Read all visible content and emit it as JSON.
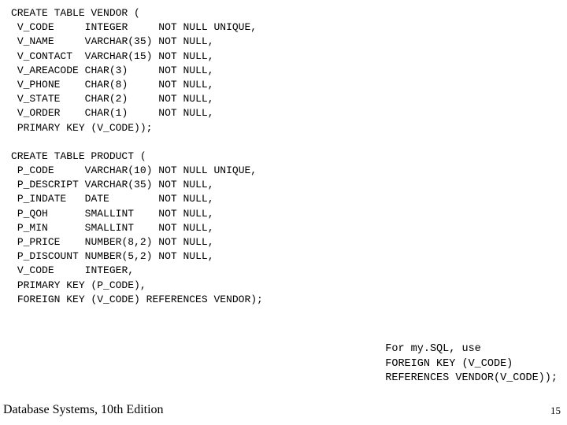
{
  "vendor": {
    "header": "CREATE TABLE VENDOR (",
    "rows": [
      {
        "col": "V_CODE",
        "type": "INTEGER",
        "cons": "NOT NULL UNIQUE,"
      },
      {
        "col": "V_NAME",
        "type": "VARCHAR(35)",
        "cons": "NOT NULL,"
      },
      {
        "col": "V_CONTACT",
        "type": "VARCHAR(15)",
        "cons": "NOT NULL,"
      },
      {
        "col": "V_AREACODE",
        "type": "CHAR(3)",
        "cons": "NOT NULL,"
      },
      {
        "col": "V_PHONE",
        "type": "CHAR(8)",
        "cons": "NOT NULL,"
      },
      {
        "col": "V_STATE",
        "type": "CHAR(2)",
        "cons": "NOT NULL,"
      },
      {
        "col": "V_ORDER",
        "type": "CHAR(1)",
        "cons": "NOT NULL,"
      }
    ],
    "footer": "PRIMARY KEY (V_CODE));"
  },
  "product": {
    "header": "CREATE TABLE PRODUCT (",
    "rows": [
      {
        "col": "P_CODE",
        "type": "VARCHAR(10)",
        "cons": "NOT NULL UNIQUE,"
      },
      {
        "col": "P_DESCRIPT",
        "type": "VARCHAR(35)",
        "cons": "NOT NULL,"
      },
      {
        "col": "P_INDATE",
        "type": "DATE",
        "cons": "NOT NULL,"
      },
      {
        "col": "P_QOH",
        "type": "SMALLINT",
        "cons": "NOT NULL,"
      },
      {
        "col": "P_MIN",
        "type": "SMALLINT",
        "cons": "NOT NULL,"
      },
      {
        "col": "P_PRICE",
        "type": "NUMBER(8,2)",
        "cons": "NOT NULL,"
      },
      {
        "col": "P_DISCOUNT",
        "type": "NUMBER(5,2)",
        "cons": "NOT NULL,"
      },
      {
        "col": "V_CODE",
        "type": "INTEGER,",
        "cons": ""
      }
    ],
    "footer1": "PRIMARY KEY (P_CODE),",
    "footer2": "FOREIGN KEY (V_CODE) REFERENCES VENDOR);"
  },
  "annotation": {
    "line1": "For my.SQL, use",
    "line2": "FOREIGN KEY (V_CODE)",
    "line3": "REFERENCES VENDOR(V_CODE));"
  },
  "footer_text": "Database Systems, 10th Edition",
  "page_number": "15"
}
